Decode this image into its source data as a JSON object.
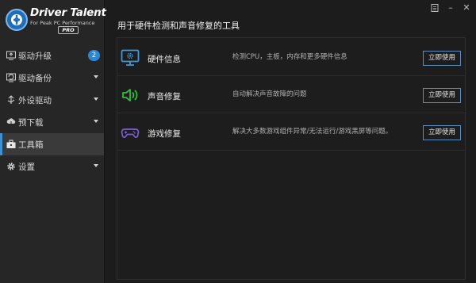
{
  "logo": {
    "title": "Driver Talent",
    "subtitle": "For Peak PC Performance",
    "edition": "PRO"
  },
  "window": {
    "menu_icon": "menu-icon",
    "close_glyph": "✕"
  },
  "sidebar": {
    "items": [
      {
        "label": "驱动升级",
        "icon": "monitor-upgrade-icon",
        "badge": "2",
        "caret": false
      },
      {
        "label": "驱动备份",
        "icon": "backup-icon",
        "badge": null,
        "caret": true
      },
      {
        "label": "外设驱动",
        "icon": "peripheral-icon",
        "badge": null,
        "caret": true
      },
      {
        "label": "预下载",
        "icon": "cloud-download-icon",
        "badge": null,
        "caret": true
      },
      {
        "label": "工具箱",
        "icon": "toolbox-icon",
        "badge": null,
        "caret": false,
        "active": true
      },
      {
        "label": "设置",
        "icon": "gear-icon",
        "badge": null,
        "caret": true
      }
    ]
  },
  "main": {
    "title": "用于硬件检测和声音修复的工具",
    "tools": [
      {
        "name": "硬件信息",
        "description": "检测CPU，主板，内存和更多硬件信息",
        "button": "立即使用",
        "icon": "monitor-settings-icon"
      },
      {
        "name": "声音修复",
        "description": "自动解决声音故障的问题",
        "button": "立即使用",
        "icon": "speaker-icon"
      },
      {
        "name": "游戏修复",
        "description": "解决大多数游戏组件异常/无法运行/游戏黑屏等问题。",
        "button": "立即使用",
        "icon": "gamepad-icon"
      }
    ]
  },
  "colors": {
    "accent": "#2d86d6",
    "sound_icon": "#2fbf3a",
    "game_icon": "#7b5bd6",
    "button_border": "#5c8fbd"
  }
}
